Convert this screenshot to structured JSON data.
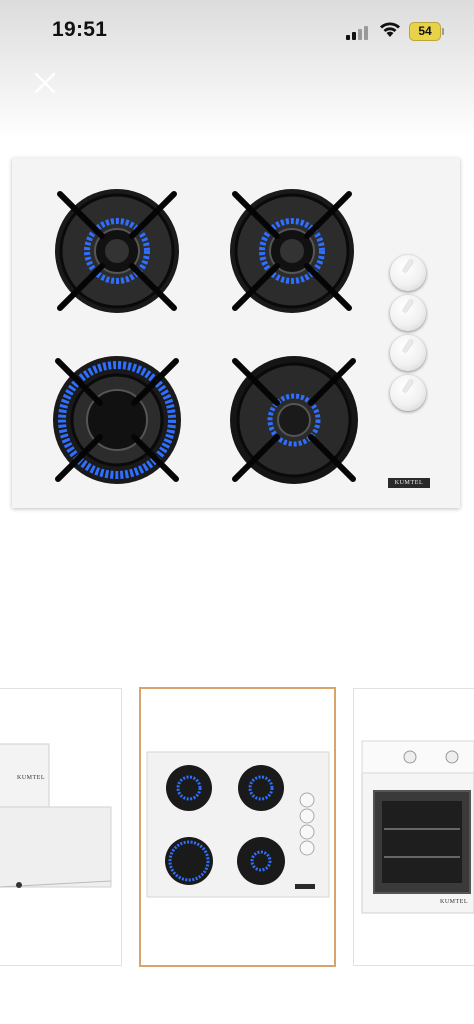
{
  "status_bar": {
    "time": "19:51",
    "battery": "54"
  },
  "main_image": {
    "brand": "KUMTEL"
  },
  "thumbnails": [
    {
      "brand": "KUMTEL"
    },
    {
      "brand": "KUMTEL"
    },
    {
      "brand": "KUMTEL"
    }
  ],
  "colors": {
    "flame": "#2f6fff",
    "selected_border": "#d7a46b"
  }
}
